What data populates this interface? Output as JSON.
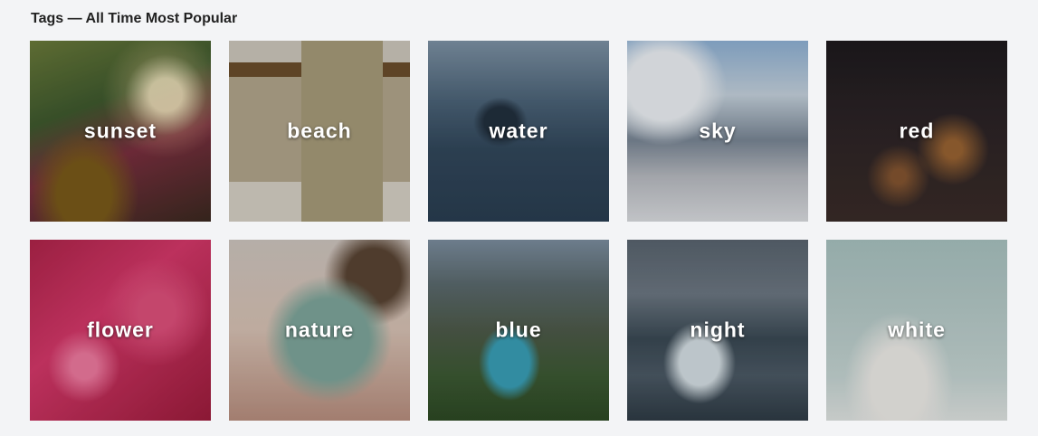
{
  "heading": "Tags — All Time Most Popular",
  "tags": [
    {
      "label": "sunset",
      "icon": "photo-sunset"
    },
    {
      "label": "beach",
      "icon": "photo-beach"
    },
    {
      "label": "water",
      "icon": "photo-water"
    },
    {
      "label": "sky",
      "icon": "photo-sky"
    },
    {
      "label": "red",
      "icon": "photo-red"
    },
    {
      "label": "flower",
      "icon": "photo-flower"
    },
    {
      "label": "nature",
      "icon": "photo-nature"
    },
    {
      "label": "blue",
      "icon": "photo-blue"
    },
    {
      "label": "night",
      "icon": "photo-night"
    },
    {
      "label": "white",
      "icon": "photo-white"
    }
  ]
}
